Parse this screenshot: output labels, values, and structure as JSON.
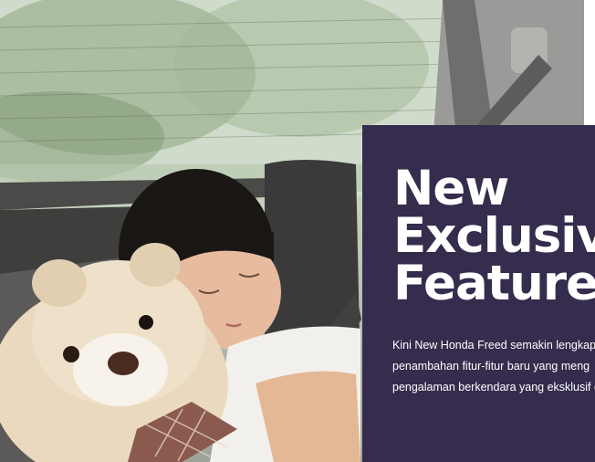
{
  "photo": {
    "subject": "girl-sleeping-with-teddy-bear",
    "icon": "car-interior-photo"
  },
  "panel": {
    "background": "#352c4e",
    "text_color": "#ffffff",
    "headline": [
      "New",
      "Exclusive",
      "Features"
    ],
    "body_lines": [
      "Kini New Honda Freed semakin lengkap",
      "penambahan fitur-fitur baru yang meng",
      "pengalaman berkendara yang eksklusif d"
    ]
  }
}
